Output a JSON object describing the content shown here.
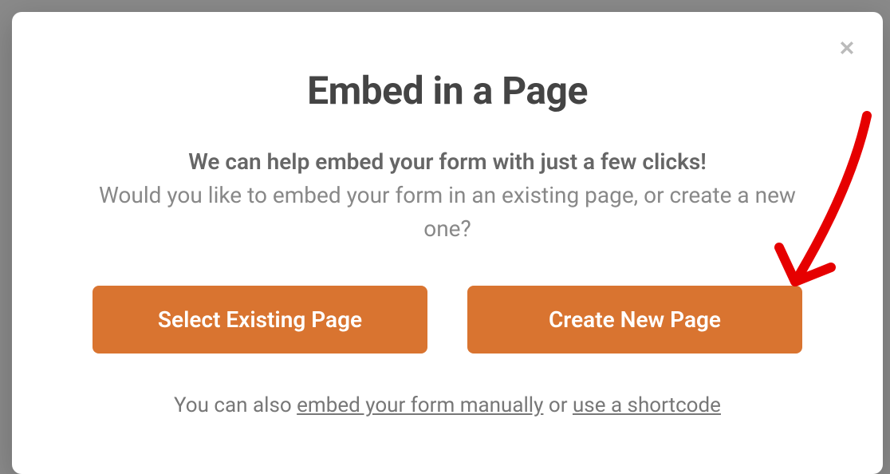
{
  "modal": {
    "title": "Embed in a Page",
    "subtitle_bold": "We can help embed your form with just a few clicks!",
    "subtitle_normal": "Would you like to embed your form in an existing page, or create a new one?",
    "buttons": {
      "select_existing": "Select Existing Page",
      "create_new": "Create New Page"
    },
    "footer": {
      "prefix": "You can also ",
      "link_manual": "embed your form manually",
      "middle": " or ",
      "link_shortcode": "use a shortcode"
    }
  }
}
